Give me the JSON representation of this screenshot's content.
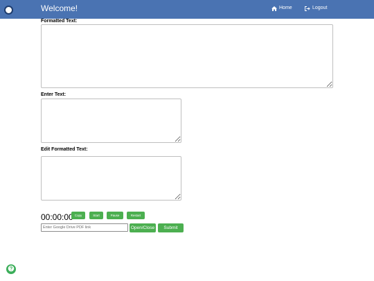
{
  "navbar": {
    "title": "Welcome!",
    "home_label": "Home",
    "logout_label": "Logout",
    "home_icon": "home-icon",
    "logout_icon": "logout-icon"
  },
  "sections": {
    "formatted_text_label": "Formatted Text:",
    "enter_text_label": "Enter Text:",
    "edit_formatted_text_label": "Edit Formatted Text:"
  },
  "timer": {
    "display": "00:00:00",
    "copy_label": "Copy",
    "start_label": "Start",
    "pause_label": "Pause",
    "restart_label": "Restart"
  },
  "pdf": {
    "placeholder": "Enter Google Drive PDF link",
    "open_close_label": "Open/Close",
    "submit_label": "Submit"
  },
  "colors": {
    "navbar": "#4a73b2",
    "button_green": "#4caf50",
    "fab_green": "#3cae5a"
  }
}
